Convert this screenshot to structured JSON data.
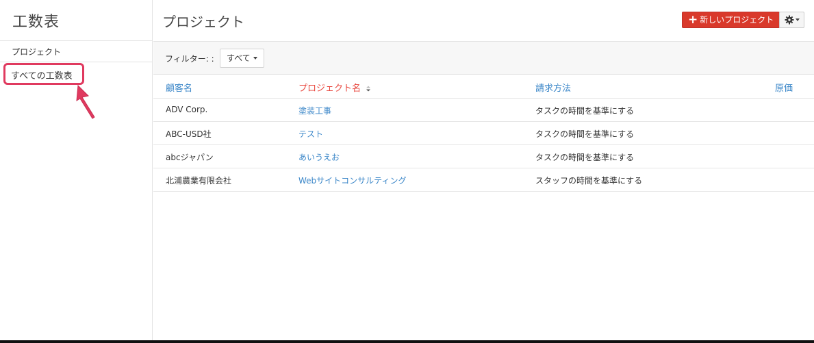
{
  "sidebar": {
    "app_title": "工数表",
    "items": [
      {
        "label": "プロジェクト"
      },
      {
        "label": "すべての工数表"
      }
    ]
  },
  "header": {
    "title": "プロジェクト",
    "new_project_button": "新しいプロジェクト",
    "new_project_icon": "+",
    "settings_icon": "gear-icon"
  },
  "filter": {
    "label": "フィルター: :",
    "selected": "すべて"
  },
  "table": {
    "columns": [
      "顧客名",
      "プロジェクト名",
      "請求方法",
      "原価"
    ],
    "sorted_column": "プロジェクト名",
    "rows": [
      {
        "customer": "ADV Corp.",
        "project": "塗装工事",
        "billing": "タスクの時間を基準にする",
        "cost": ""
      },
      {
        "customer": "ABC-USD社",
        "project": "テスト",
        "billing": "タスクの時間を基準にする",
        "cost": ""
      },
      {
        "customer": "abcジャパン",
        "project": "あいうえお",
        "billing": "タスクの時間を基準にする",
        "cost": ""
      },
      {
        "customer": "北浦農業有限会社",
        "project": "Webサイトコンサルティング",
        "billing": "スタッフの時間を基準にする",
        "cost": ""
      }
    ]
  },
  "colors": {
    "accent_red": "#d9392b",
    "link_blue": "#3a86c8",
    "highlight_pink": "#e03a5f"
  }
}
